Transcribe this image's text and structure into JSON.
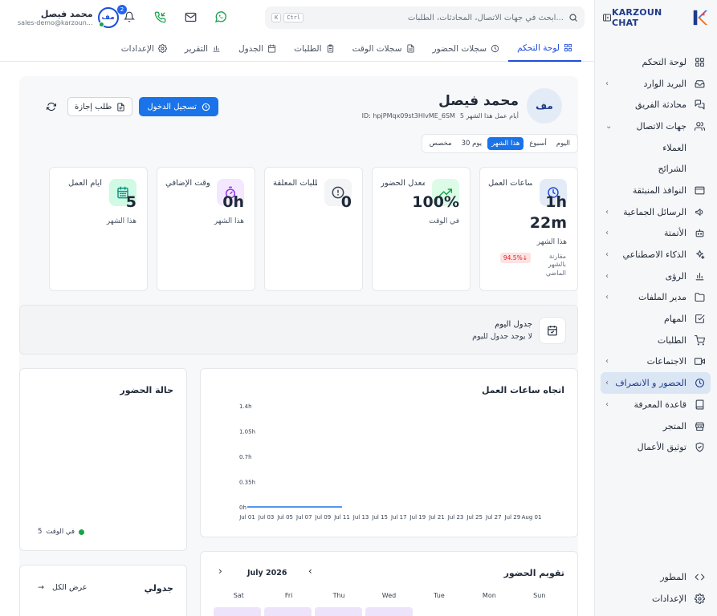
{
  "brand": {
    "name": "KARZOUN CHAT"
  },
  "sidebar": {
    "items": [
      {
        "label": "لوحة التحكم",
        "icon": "dashboard-icon",
        "chevron": false
      },
      {
        "label": "البريد الوارد",
        "icon": "inbox-icon",
        "chevron": true
      },
      {
        "label": "محادثة الفريق",
        "icon": "team-chat-icon",
        "chevron": false
      },
      {
        "label": "جهات الاتصال",
        "icon": "contacts-icon",
        "chevron": true,
        "expanded": true
      },
      {
        "label": "العملاء",
        "icon": "",
        "chevron": false,
        "sub": true
      },
      {
        "label": "الشرائح",
        "icon": "",
        "chevron": false,
        "sub": true
      },
      {
        "label": "النوافذ المنبثقة",
        "icon": "popup-icon",
        "chevron": false
      },
      {
        "label": "الرسائل الجماعية",
        "icon": "megaphone-icon",
        "chevron": true
      },
      {
        "label": "الأتمتة",
        "icon": "bot-icon",
        "chevron": true
      },
      {
        "label": "الذكاء الاصطناعي",
        "icon": "sparkles-icon",
        "chevron": true
      },
      {
        "label": "الرؤى",
        "icon": "bar-chart-icon",
        "chevron": true
      },
      {
        "label": "مدير الملفات",
        "icon": "folder-icon",
        "chevron": true
      },
      {
        "label": "المهام",
        "icon": "checkbox-icon",
        "chevron": false
      },
      {
        "label": "الطلبات",
        "icon": "cart-icon",
        "chevron": false
      },
      {
        "label": "الاجتماعات",
        "icon": "video-icon",
        "chevron": true
      },
      {
        "label": "الحضور و الانصراف",
        "icon": "clock-icon",
        "chevron": true,
        "active": true
      },
      {
        "label": "قاعدة المعرفة",
        "icon": "book-icon",
        "chevron": true
      },
      {
        "label": "المتجر",
        "icon": "store-icon",
        "chevron": false
      },
      {
        "label": "توثيق الأعمال",
        "icon": "shield-check-icon",
        "chevron": false
      }
    ],
    "bottom": [
      {
        "label": "المطور",
        "icon": "code-icon"
      },
      {
        "label": "الإعدادات",
        "icon": "gear-icon"
      }
    ]
  },
  "search": {
    "placeholder": "ابحث في جهات الاتصال، المحادثات، الطلبات...",
    "kbd1": "K",
    "kbd2": "Ctrl"
  },
  "topbar": {
    "notifications_count": "2"
  },
  "user": {
    "name": "محمد فيصل",
    "email": "sales-demo@karzoun...",
    "initials": "مف"
  },
  "tabs": [
    {
      "label": "لوحة التحكم",
      "icon": "grid-icon",
      "active": true
    },
    {
      "label": "سجلات الحضور",
      "icon": "clock-icon"
    },
    {
      "label": "سجلات الوقت",
      "icon": "file-icon"
    },
    {
      "label": "الطلبات",
      "icon": "clipboard-icon"
    },
    {
      "label": "الجدول",
      "icon": "calendar-icon"
    },
    {
      "label": "التقرير",
      "icon": "bar-chart-icon"
    },
    {
      "label": "الإعدادات",
      "icon": "gear-icon"
    }
  ],
  "profile": {
    "name": "محمد فيصل",
    "initials": "مف",
    "id": "ID: hpjPMqx09st3HlvME_6SM",
    "workdays": "5 أيام عمل هذا الشهر"
  },
  "actions": {
    "checkin": "تسجيل الدخول",
    "leave": "طلب إجازة"
  },
  "ranges": [
    {
      "label": "اليوم"
    },
    {
      "label": "أسبوع"
    },
    {
      "label": "هذا الشهر",
      "active": true
    },
    {
      "label": "30 يوم"
    },
    {
      "label": "مخصص"
    }
  ],
  "stats": [
    {
      "label": "ساعات العمل",
      "value": "1h 22m",
      "sub": "هذا الشهر",
      "icon": "clock-icon",
      "compare_badge": "94.5%↓",
      "compare_text": "مقارنة بالشهر الماضي"
    },
    {
      "label": "معدل الحضور",
      "value": "100%",
      "sub": "في الوقت",
      "icon": "trend-up-icon"
    },
    {
      "label": "الطلبات المعلقة",
      "value": "0",
      "sub": "",
      "icon": "alert-circle-icon"
    },
    {
      "label": "الوقت الإضافي",
      "value": "0h",
      "sub": "هذا الشهر",
      "icon": "stopwatch-icon"
    },
    {
      "label": "أيام العمل",
      "value": "5",
      "sub": "هذا الشهر",
      "icon": "calendar-grid-icon"
    }
  ],
  "today_schedule": {
    "title": "جدول اليوم",
    "subtitle": "لا يوجد جدول لليوم"
  },
  "trend_card": {
    "title": "اتجاه ساعات العمل"
  },
  "attendance_card": {
    "title": "حالة الحضور",
    "legend_label": "في الوقت",
    "legend_value": "5"
  },
  "calendar_card": {
    "title": "تقويم الحضور",
    "month": "July 2026",
    "weekdays": [
      "Sun",
      "Mon",
      "Tue",
      "Wed",
      "Thu",
      "Fri",
      "Sat"
    ]
  },
  "my_schedule": {
    "title": "جدولي",
    "view_all": "عرض الكل"
  },
  "chart_data": {
    "type": "line",
    "x": [
      "Jul 01",
      "Jul 03",
      "Jul 05",
      "Jul 07",
      "Jul 09",
      "Jul 11",
      "Jul 13",
      "Jul 15",
      "Jul 17",
      "Jul 19",
      "Jul 21",
      "Jul 23",
      "Jul 25",
      "Jul 27",
      "Jul 29",
      "Aug 01"
    ],
    "series": [
      {
        "values": [
          0,
          0,
          0,
          0,
          0,
          0
        ]
      }
    ],
    "yticks": [
      "0h",
      "0.35h",
      "0.7h",
      "1.05h",
      "1.4h"
    ],
    "ylim": [
      0,
      1.4
    ],
    "color": "#1a73e8"
  }
}
